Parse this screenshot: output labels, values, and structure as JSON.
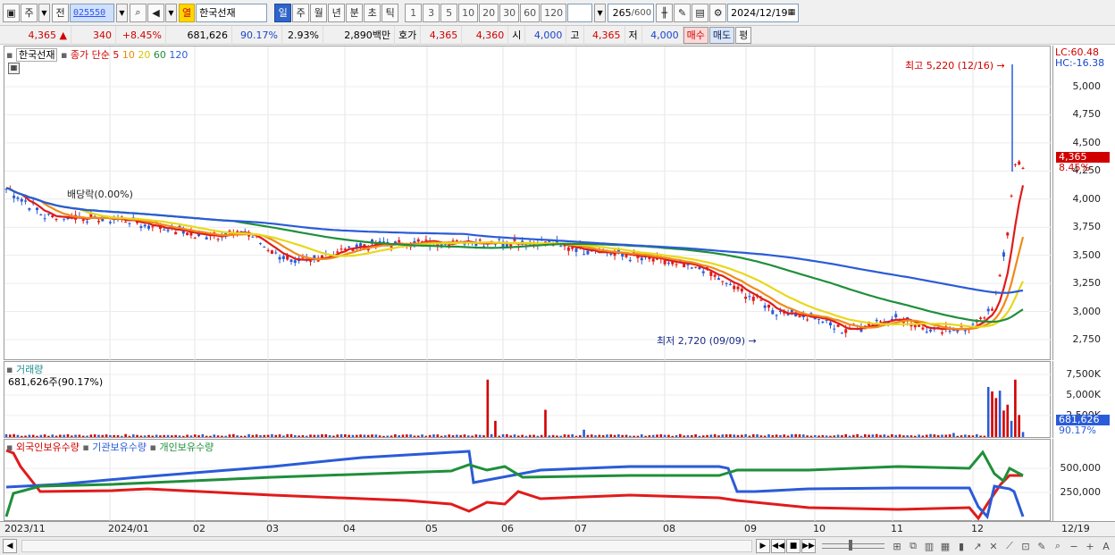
{
  "toolbar": {
    "type_label": "주",
    "prev_label": "전",
    "stock_code": "025550",
    "badge_label": "열",
    "stock_name": "한국선재",
    "period_tabs": [
      "일",
      "주",
      "월",
      "년",
      "분",
      "초",
      "틱"
    ],
    "active_period": "일",
    "intervals": [
      "1",
      "3",
      "5",
      "10",
      "20",
      "30",
      "60",
      "120"
    ],
    "count_value": "265",
    "count_max": "/600",
    "date": "2024/12/19"
  },
  "quote": {
    "price": "4,365",
    "change": "340",
    "change_pct": "+8.45%",
    "volume": "681,626",
    "vol_ratio": "90.17%",
    "turnover": "2.93%",
    "amount": "2,890백만",
    "ask_label": "호가",
    "ask": "4,365",
    "bid": "4,360",
    "open_label": "시",
    "open": "4,000",
    "high_label": "고",
    "high": "4,365",
    "low_label": "저",
    "low": "4,000",
    "buy_label": "매수",
    "sell_label": "매도",
    "eval_label": "평"
  },
  "price_pane": {
    "title": "한국선재",
    "legend_prefix": "종가 단순",
    "ma_periods": [
      "5",
      "10",
      "20",
      "60",
      "120"
    ],
    "ma_colors": [
      "#e01b1b",
      "#f08a1a",
      "#e8d81a",
      "#1f8f3a",
      "#2a5bd8"
    ],
    "lc": "LC:60.48",
    "hc": "HC:-16.38",
    "y_ticks": [
      "5,000",
      "4,750",
      "4,500",
      "4,250",
      "4,000",
      "3,750",
      "3,500",
      "3,250",
      "3,000",
      "2,750"
    ],
    "current_price_tag": "4,365",
    "current_pct_tag": "8.45%",
    "high_note": "최고 5,220 (12/16)",
    "low_note": "최저 2,720 (09/09)",
    "dividend_note": "배당락(0.00%)"
  },
  "volume_pane": {
    "title": "거래량",
    "current": "681,626주(90.17%)",
    "y_ticks": [
      "7,500K",
      "5,000K",
      "2,500K"
    ],
    "tag_value": "681,626",
    "tag_pct": "90.17%"
  },
  "owner_pane": {
    "legend": [
      "외국인보유수량",
      "기관보유수량",
      "개인보유수량"
    ],
    "legend_colors": [
      "#e01b1b",
      "#2a5bd8",
      "#1f8f3a"
    ],
    "y_ticks": [
      "500,000",
      "250,000"
    ]
  },
  "x_axis": [
    "2023/11",
    "2024/01",
    "02",
    "03",
    "04",
    "05",
    "06",
    "07",
    "08",
    "09",
    "10",
    "11",
    "12",
    "12/19"
  ]
}
